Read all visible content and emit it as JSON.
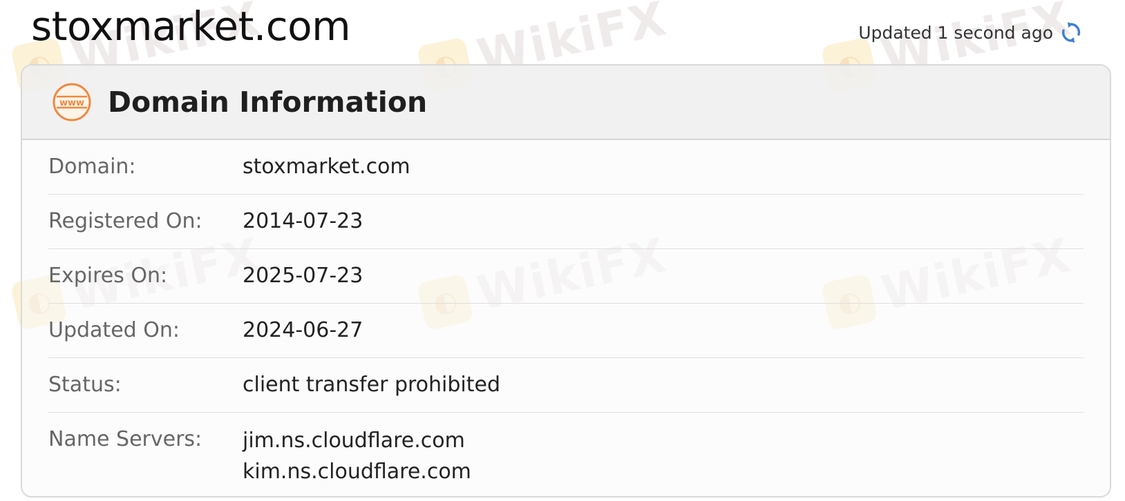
{
  "page": {
    "title": "stoxmarket.com",
    "updated_text": "Updated 1 second ago"
  },
  "card": {
    "title": "Domain Information",
    "icon_text": "www"
  },
  "rows": [
    {
      "label": "Domain:",
      "value": "stoxmarket.com"
    },
    {
      "label": "Registered On:",
      "value": "2014-07-23"
    },
    {
      "label": "Expires On:",
      "value": "2025-07-23"
    },
    {
      "label": "Updated On:",
      "value": "2024-06-27"
    },
    {
      "label": "Status:",
      "value": "client transfer prohibited"
    },
    {
      "label": "Name Servers:",
      "values": [
        "jim.ns.cloudflare.com",
        "kim.ns.cloudflare.com"
      ]
    }
  ],
  "watermark": {
    "text": "WikiFX"
  },
  "colors": {
    "accent_orange": "#f0883e",
    "refresh_blue": "#3d7fd6",
    "label_gray": "#666666"
  },
  "icons": {
    "refresh": "refresh-icon",
    "www": "www-icon"
  }
}
